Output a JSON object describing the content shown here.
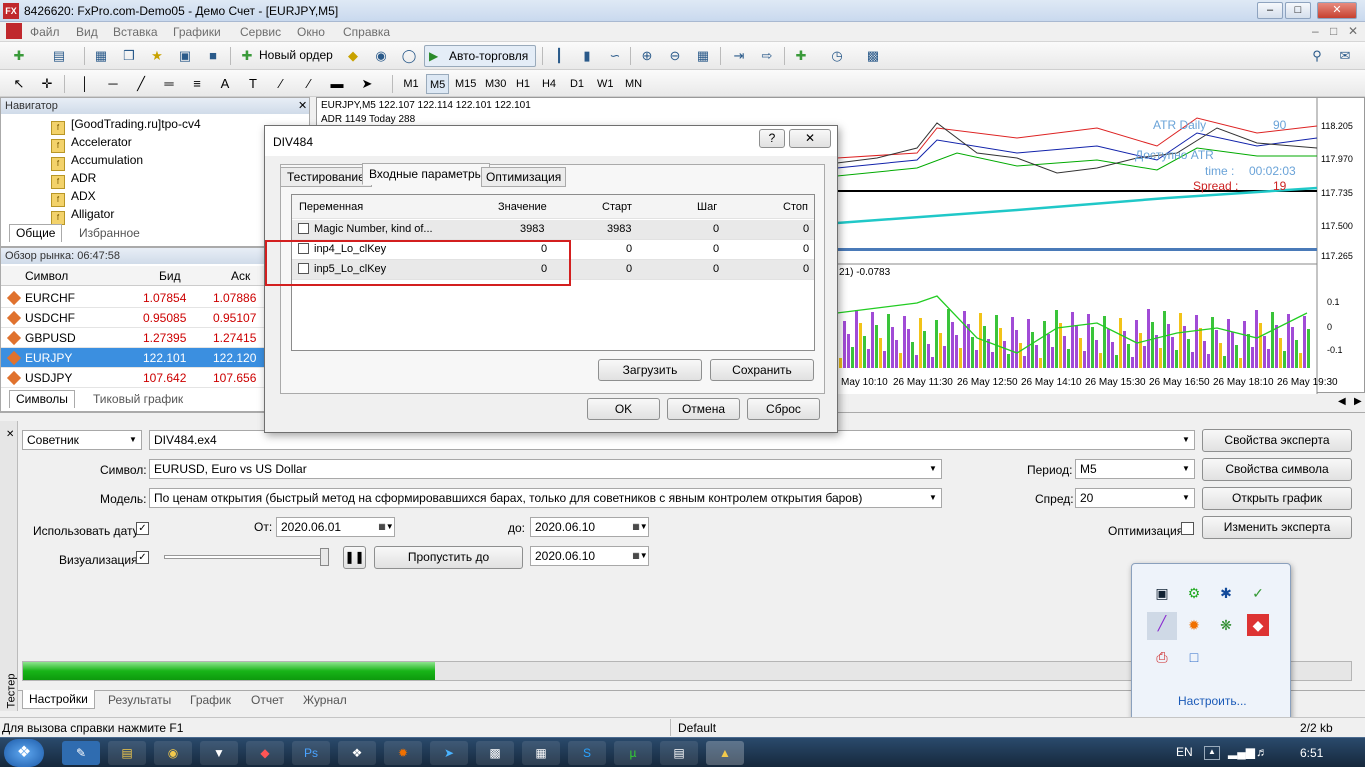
{
  "window": {
    "app_badge": "FX",
    "title": "8426620: FxPro.com-Demo05 - Демо Счет - [EURJPY,M5]"
  },
  "menu": [
    "Файл",
    "Вид",
    "Вставка",
    "Графики",
    "Сервис",
    "Окно",
    "Справка"
  ],
  "toolbar": {
    "new_order": "Новый ордер",
    "autotrading": "Авто-торговля"
  },
  "timeframes": [
    "M1",
    "M5",
    "M15",
    "M30",
    "H1",
    "H4",
    "D1",
    "W1",
    "MN"
  ],
  "navigator": {
    "header": "Навигатор",
    "items": [
      "[GoodTrading.ru]tpo-cv4",
      "Accelerator",
      "Accumulation",
      "ADR",
      "ADX",
      "Alligator"
    ],
    "tabs": [
      "Общие",
      "Избранное"
    ]
  },
  "market_watch": {
    "header": "Обзор рынка: 06:47:58",
    "columns": [
      "Символ",
      "Бид",
      "Аск"
    ],
    "rows": [
      {
        "symbol": "EURCHF",
        "bid": "1.07854",
        "ask": "1.07886"
      },
      {
        "symbol": "USDCHF",
        "bid": "0.95085",
        "ask": "0.95107"
      },
      {
        "symbol": "GBPUSD",
        "bid": "1.27395",
        "ask": "1.27415"
      },
      {
        "symbol": "EURJPY",
        "bid": "122.101",
        "ask": "122.120"
      },
      {
        "symbol": "USDJPY",
        "bid": "107.642",
        "ask": "107.656"
      }
    ],
    "tabs": [
      "Символы",
      "Тиковый график"
    ]
  },
  "chart": {
    "info": "EURJPY,M5  122.107 122.114 122.101 122.101",
    "adr": "ADR 1149  Today 288",
    "atr_label": "ATR Daily",
    "atr_value": "90",
    "avail_label": "Доступно ATR",
    "time_label": "time :",
    "time_value": "00:02:03",
    "spread_label": "Spread :",
    "spread_value": "19",
    "prices": [
      "118.205",
      "117.970",
      "117.735",
      "117.500",
      "117.265"
    ],
    "osc_label": "21) -0.0783",
    "osc_prices": [
      "0.1",
      "0",
      "-0.1"
    ],
    "times": [
      "May 10:10",
      "26 May 11:30",
      "26 May 12:50",
      "26 May 14:10",
      "26 May 15:30",
      "26 May 16:50",
      "26 May 18:10",
      "26 May 19:30"
    ]
  },
  "dialog": {
    "title": "DIV484",
    "help": "?",
    "tabs": [
      "Тестирование",
      "Входные параметры",
      "Оптимизация"
    ],
    "columns": [
      "Переменная",
      "Значение",
      "Старт",
      "Шаг",
      "Стоп"
    ],
    "rows": [
      {
        "name": "Magic Number, kind of...",
        "value": "3983",
        "start": "3983",
        "step": "0",
        "stop": "0"
      },
      {
        "name": "inp4_Lo_clKey",
        "value": "0",
        "start": "0",
        "step": "0",
        "stop": "0"
      },
      {
        "name": "inp5_Lo_clKey",
        "value": "0",
        "start": "0",
        "step": "0",
        "stop": "0"
      }
    ],
    "load": "Загрузить",
    "save": "Сохранить",
    "ok": "OK",
    "cancel": "Отмена",
    "reset": "Сброс"
  },
  "tester": {
    "type": "Советник",
    "expert": "DIV484.ex4",
    "symbol_label": "Символ:",
    "symbol": "EURUSD, Euro vs US Dollar",
    "model_label": "Модель:",
    "model": "По ценам открытия (быстрый метод на сформировавшихся барах, только для советников с явным контролем открытия баров)",
    "use_date": "Использовать дату",
    "from_label": "От:",
    "from": "2020.06.01",
    "to_label": "до:",
    "to": "2020.06.10",
    "visual": "Визуализация",
    "skip_to": "Пропустить до",
    "skip_date": "2020.06.10",
    "period_label": "Период:",
    "period": "M5",
    "spread_label": "Спред:",
    "spread": "20",
    "optimization": "Оптимизация",
    "btn_expert_props": "Свойства эксперта",
    "btn_symbol_props": "Свойства символа",
    "btn_open_chart": "Открыть график",
    "btn_modify_expert": "Изменить эксперта",
    "progress": 0.31,
    "side_label": "Тестер",
    "tabs": [
      "Настройки",
      "Результаты",
      "График",
      "Отчет",
      "Журнал"
    ]
  },
  "status": {
    "help": "Для вызова справки нажмите F1",
    "profile": "Default",
    "traffic": "2/2 kb"
  },
  "tray": {
    "customize": "Настроить...",
    "lang": "EN",
    "clock": "6:51"
  }
}
